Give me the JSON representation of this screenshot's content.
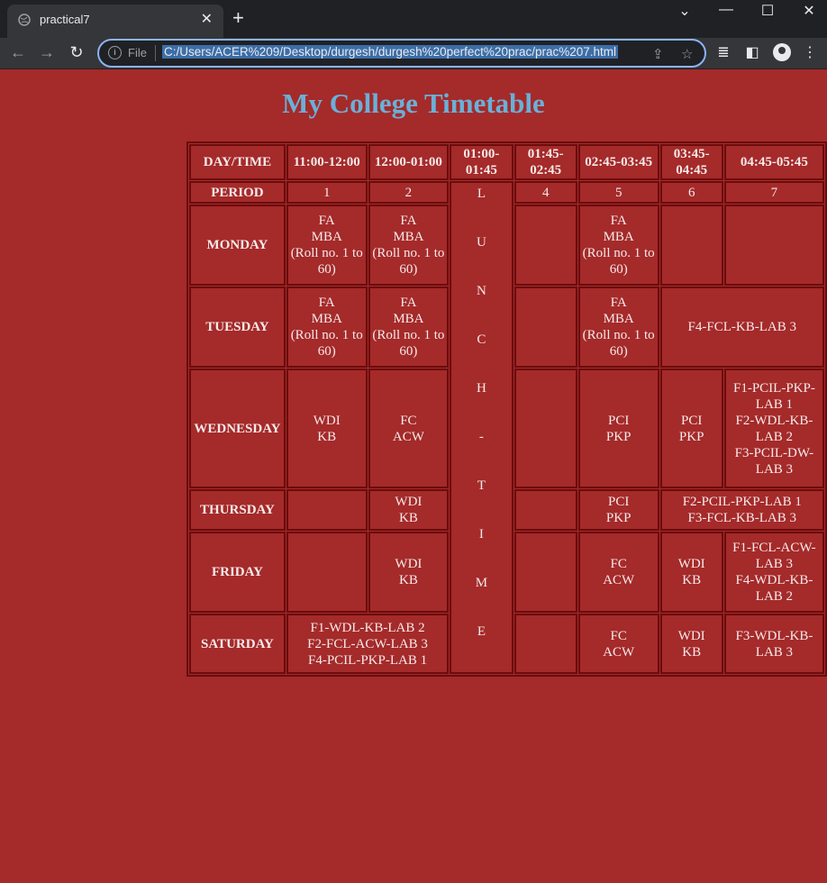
{
  "browser": {
    "tab_title": "practical7",
    "url": "C:/Users/ACER%209/Desktop/durgesh/durgesh%20perfect%20prac/prac%207.html",
    "scheme_label": "File"
  },
  "page": {
    "heading": "My College Timetable",
    "header_row": [
      "DAY/TIME",
      "11:00-12:00",
      "12:00-01:00",
      "01:00-01:45",
      "01:45-02:45",
      "02:45-03:45",
      "03:45-04:45",
      "04:45-05:45"
    ],
    "period_label": "PERIOD",
    "periods": [
      "1",
      "2",
      "4",
      "5",
      "6",
      "7"
    ],
    "lunch_letters": [
      "L",
      "U",
      "N",
      "C",
      "H",
      "-",
      "T",
      "I",
      "M",
      "E"
    ],
    "days": [
      "MONDAY",
      "TUESDAY",
      "WEDNESDAY",
      "THURSDAY",
      "FRIDAY",
      "SATURDAY"
    ],
    "cells": {
      "fa_mba": [
        "FA",
        "MBA",
        "(Roll no. 1 to 60)"
      ],
      "tue_lab": "F4-FCL-KB-LAB 3",
      "wed": {
        "p1": [
          "WDI",
          "KB"
        ],
        "p2": [
          "FC",
          "ACW"
        ],
        "p5": [
          "PCI",
          "PKP"
        ],
        "p6": [
          "PCI",
          "PKP"
        ],
        "p7": [
          "F1-PCIL-PKP-LAB 1",
          "F2-WDL-KB-LAB 2",
          "F3-PCIL-DW-LAB 3"
        ]
      },
      "thu": {
        "p2": [
          "WDI",
          "KB"
        ],
        "p5": [
          "PCI",
          "PKP"
        ],
        "p67": [
          "F2-PCIL-PKP-LAB 1",
          "F3-FCL-KB-LAB 3"
        ]
      },
      "fri": {
        "p2": [
          "WDI",
          "KB"
        ],
        "p5": [
          "FC",
          "ACW"
        ],
        "p6": [
          "WDI",
          "KB"
        ],
        "p7": [
          "F1-FCL-ACW-LAB 3",
          "F4-WDL-KB-LAB 2"
        ]
      },
      "sat": {
        "p12": [
          "F1-WDL-KB-LAB 2",
          "F2-FCL-ACW-LAB 3",
          "F4-PCIL-PKP-LAB 1"
        ],
        "p5": [
          "FC",
          "ACW"
        ],
        "p6": [
          "WDI",
          "KB"
        ],
        "p7": [
          "F3-WDL-KB-LAB 3"
        ]
      }
    }
  }
}
